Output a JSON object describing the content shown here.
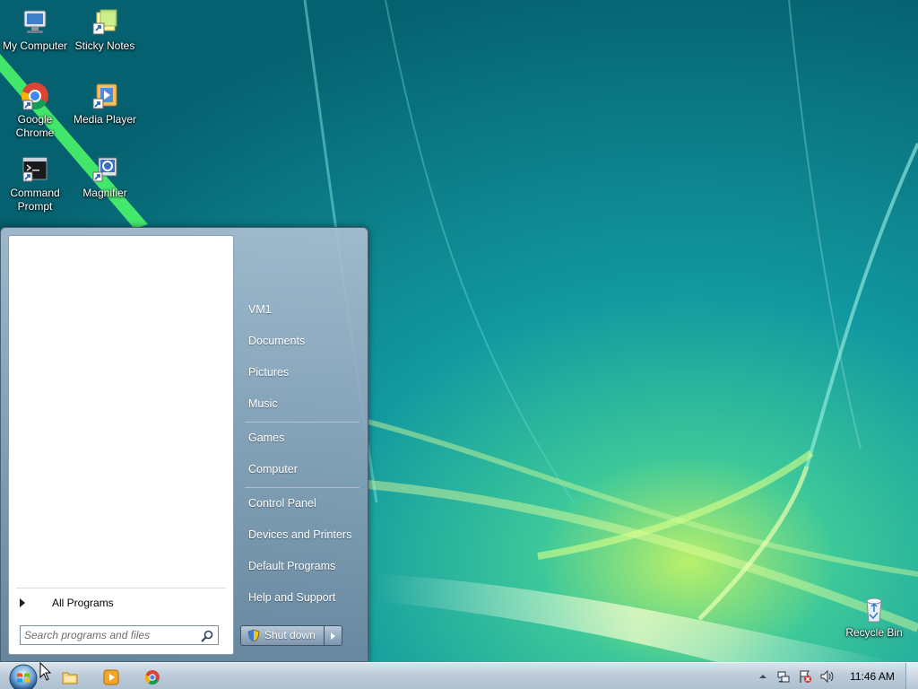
{
  "desktop": {
    "icons": [
      {
        "label": "My Computer"
      },
      {
        "label": "Sticky Notes"
      },
      {
        "label": "Google Chrome"
      },
      {
        "label": "Media Player"
      },
      {
        "label": "Command Prompt"
      },
      {
        "label": "Magnifier"
      },
      {
        "label": "Recycle Bin"
      }
    ]
  },
  "start_menu": {
    "all_programs_label": "All Programs",
    "search_placeholder": "Search programs and files",
    "right_items": [
      {
        "label": "VM1"
      },
      {
        "label": "Documents"
      },
      {
        "label": "Pictures"
      },
      {
        "label": "Music"
      },
      {
        "label": "Games"
      },
      {
        "label": "Computer"
      },
      {
        "label": "Control Panel"
      },
      {
        "label": "Devices and Printers"
      },
      {
        "label": "Default Programs"
      },
      {
        "label": "Help and Support"
      }
    ],
    "shutdown_label": "Shut down"
  },
  "taskbar": {
    "pinned": [
      {
        "icon": "explorer-folder-icon"
      },
      {
        "icon": "media-player-icon"
      },
      {
        "icon": "chrome-icon"
      }
    ],
    "tray_icons": [
      "show-hidden-icons-icon",
      "network-icon",
      "action-center-icon",
      "volume-icon"
    ],
    "clock": "11:46 AM"
  },
  "colors": {
    "wallpaper_base": "#0a7f86",
    "start_menu_glass": "#8aa2ba",
    "taskbar": "#bccbd9"
  }
}
